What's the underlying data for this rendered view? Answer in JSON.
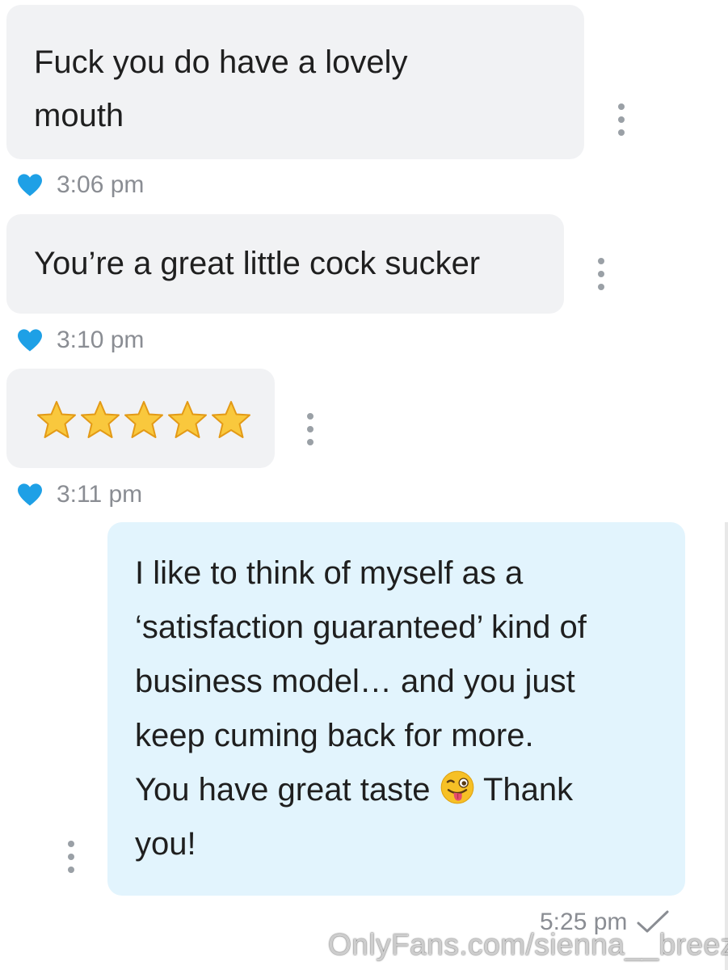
{
  "messages": [
    {
      "direction": "incoming",
      "text": "Fuck you do have a lovely\nmouth",
      "time": "3:06 pm",
      "liked": true
    },
    {
      "direction": "incoming",
      "text": "You’re a great little cock sucker",
      "time": "3:10 pm",
      "liked": true
    },
    {
      "direction": "incoming",
      "stars": 5,
      "star_count_label": "⭐⭐⭐⭐⭐",
      "time": "3:11 pm",
      "liked": true
    },
    {
      "direction": "outgoing",
      "text_before_emoji": "I like to think of myself as a\n‘satisfaction guaranteed’ kind of\nbusiness model… and you just\nkeep cuming back for more.\nYou have great taste ",
      "emoji": "winking-face-with-tongue",
      "text_after_emoji": " Thank\nyou!",
      "time": "5:25 pm",
      "status_icon": "check-icon"
    }
  ],
  "icons": {
    "like": "heart-icon",
    "more": "kebab-menu-icon",
    "sent": "check-icon"
  },
  "colors": {
    "incoming_bubble": "#f1f2f4",
    "outgoing_bubble": "#e2f4fd",
    "heart": "#1ea0e6",
    "meta_text": "#8a8d93"
  },
  "watermark": "OnlyFans.com/sienna__breeze"
}
